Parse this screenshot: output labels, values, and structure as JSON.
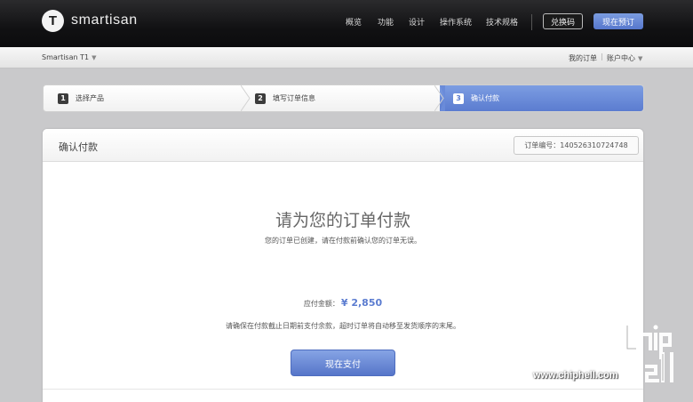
{
  "header": {
    "logo_letter": "T",
    "brand": "smartisan",
    "nav": [
      "概览",
      "功能",
      "设计",
      "操作系统",
      "技术规格"
    ],
    "redeem_label": "兑换码",
    "preorder_label": "现在预订"
  },
  "subbar": {
    "product": "Smartisan T1",
    "my_orders": "我的订单",
    "separator": "|",
    "account": "账户中心"
  },
  "steps": [
    {
      "num": "1",
      "label": "选择产品"
    },
    {
      "num": "2",
      "label": "填写订单信息"
    },
    {
      "num": "3",
      "label": "确认付款"
    }
  ],
  "active_step": 3,
  "card": {
    "title": "确认付款",
    "order_number": "订单编号：140526310724748",
    "headline": "请为您的订单付款",
    "subline": "您的订单已创建，请在付款前确认您的订单无误。",
    "amount_label": "应付金额：",
    "amount": "¥ 2,850",
    "note": "请确保在付款截止日期前支付余款，超时订单将自动移至发货顺序的末尾。",
    "pay_button": "现在支付"
  },
  "watermark": {
    "text": "www.chiphell.com",
    "logo": "chiphell-logo"
  },
  "colors": {
    "accent": "#5b7cd0",
    "header_bg": "#111113",
    "page_bg": "#c9c9cb"
  }
}
